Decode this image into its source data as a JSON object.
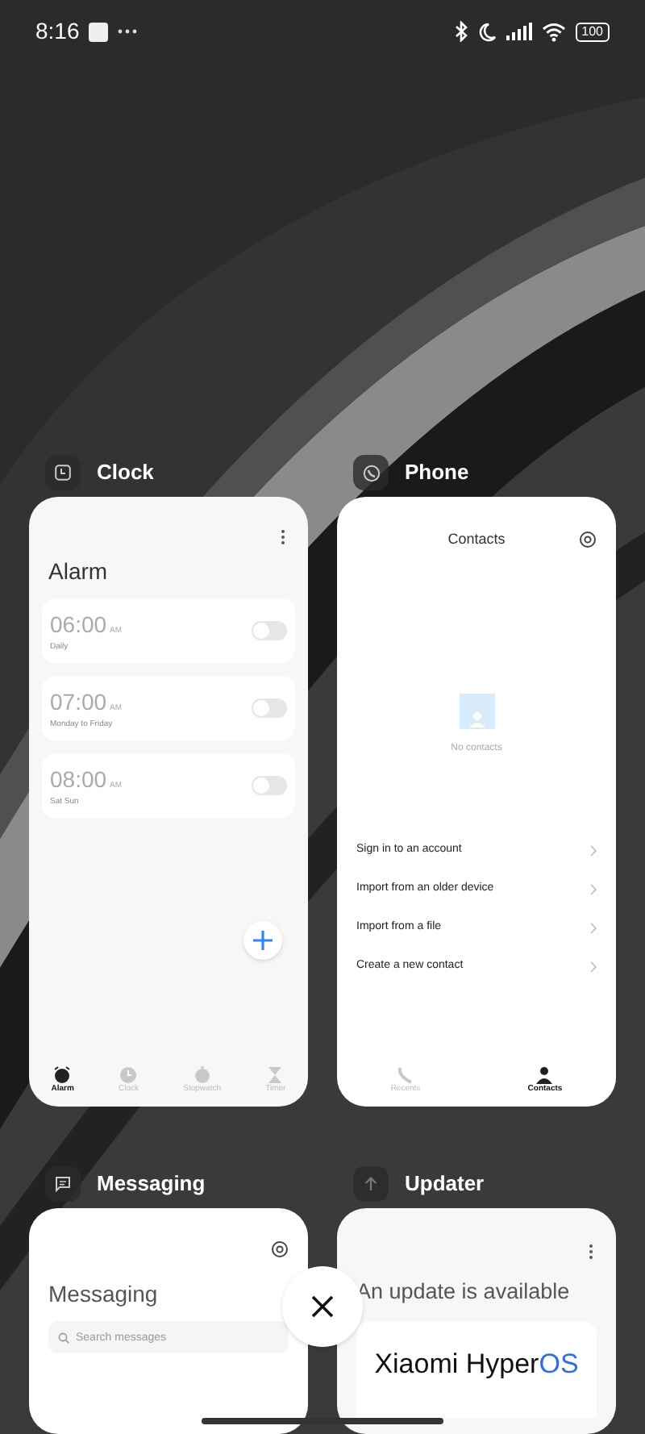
{
  "status_bar": {
    "time": "8:16",
    "battery": "100"
  },
  "apps": [
    {
      "kind": "clock",
      "name": "Clock",
      "title": "Alarm",
      "alarms": [
        {
          "time": "06:00",
          "meridiem": "AM",
          "repeat": "Daily",
          "on": false
        },
        {
          "time": "07:00",
          "meridiem": "AM",
          "repeat": "Monday to Friday",
          "on": false
        },
        {
          "time": "08:00",
          "meridiem": "AM",
          "repeat": "Sat Sun",
          "on": false
        }
      ],
      "tabs": [
        {
          "label": "Alarm",
          "selected": true
        },
        {
          "label": "Clock",
          "selected": false
        },
        {
          "label": "Stopwatch",
          "selected": false
        },
        {
          "label": "Timer",
          "selected": false
        }
      ]
    },
    {
      "kind": "phone",
      "name": "Phone",
      "title": "Contacts",
      "empty_text": "No contacts",
      "actions": [
        "Sign in to an account",
        "Import from an older device",
        "Import from a file",
        "Create a new contact"
      ],
      "tabs": [
        {
          "label": "Recents",
          "selected": false
        },
        {
          "label": "Contacts",
          "selected": true
        }
      ]
    },
    {
      "kind": "messaging",
      "name": "Messaging",
      "title": "Messaging",
      "search": {
        "placeholder": "Search messages"
      }
    },
    {
      "kind": "updater",
      "name": "Updater",
      "title": "An update is available",
      "brand": "Xiaomi Hyper",
      "brand_accent": "OS"
    }
  ]
}
